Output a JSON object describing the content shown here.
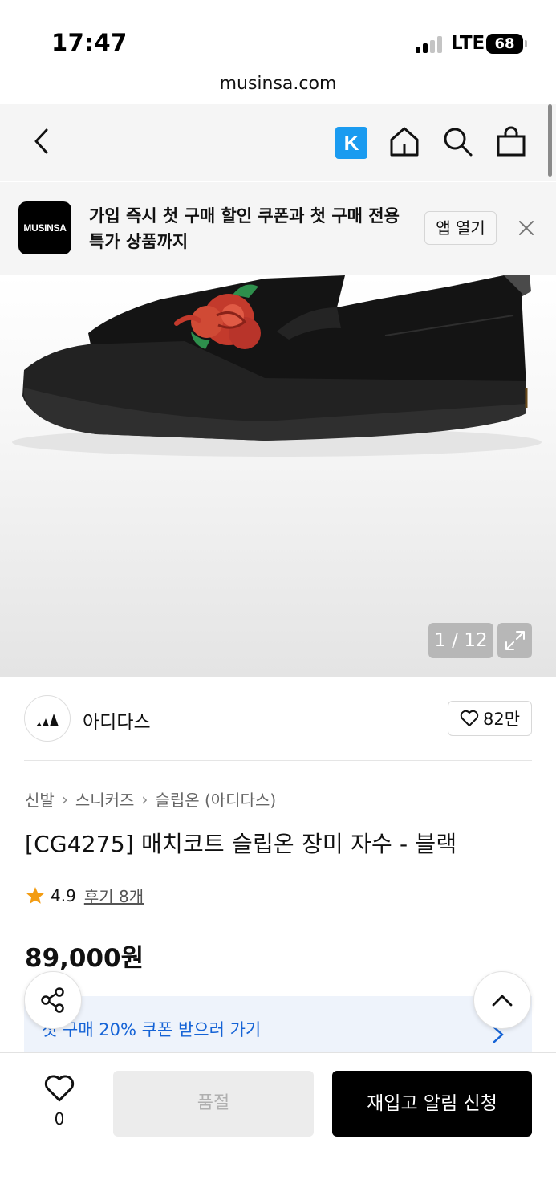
{
  "status_bar": {
    "time": "17:47",
    "network": "LTE",
    "battery": "68"
  },
  "browser": {
    "url": "musinsa.com"
  },
  "nav": {
    "k_label": "K"
  },
  "app_banner": {
    "logo_text": "MUSINSA",
    "message": "가입 즉시 첫 구매 할인 쿠폰과 첫 구매 전용 특가 상품까지",
    "open_app_label": "앱 열기"
  },
  "gallery": {
    "counter": "1 / 12"
  },
  "brand": {
    "name": "아디다스",
    "likes": "82만"
  },
  "breadcrumb": [
    "신발",
    "스니커즈",
    "슬립온 (아디다스)"
  ],
  "product": {
    "title": "[CG4275] 매치코트 슬립온 장미 자수 - 블랙",
    "rating": "4.9",
    "review_label": "후기 8개",
    "price": "89,000원"
  },
  "coupon": {
    "text": "첫 구매 20% 쿠폰 받으러 가기"
  },
  "bottom_bar": {
    "wish_count": "0",
    "soldout_label": "품절",
    "restock_label": "재입고 알림 신청"
  },
  "colors": {
    "accent_blue": "#1563d6",
    "k_badge": "#1a9bf0",
    "star": "#f39c12"
  }
}
